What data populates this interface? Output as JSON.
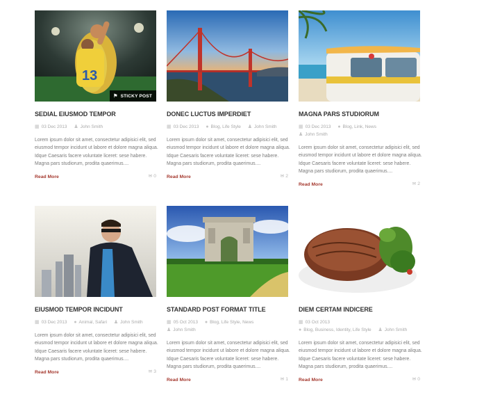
{
  "read_more_label": "Read More",
  "excerpt": "Lorem ipsum dolor sit amet, consectetur adipisici elit, sed eiusmod tempor incidunt ut labore et dolore magna aliqua. Idque Caesaris facere voluntate liceret: sese habere. Magna pars studiorum, prodita quaerimus....",
  "posts": [
    {
      "title": "SEDIAL EIUSMOD TEMPOR",
      "date": "03 Dec 2013",
      "tags": "",
      "author": "John Smith",
      "comments": "0",
      "sticky_label": "STICKY POST",
      "image": "soccer-players-photo"
    },
    {
      "title": "DONEC LUCTUS IMPERDIET",
      "date": "03 Dec 2013",
      "tags": "Blog, Life Style",
      "author": "John Smith",
      "comments": "2",
      "image": "golden-gate-bridge-photo"
    },
    {
      "title": "MAGNA PARS STUDIORUM",
      "date": "03 Dec 2013",
      "tags": "Blog, Link, News",
      "author": "John Smith",
      "comments": "2",
      "image": "surf-van-beach-photo"
    },
    {
      "title": "EIUSMOD TEMPOR INCIDUNT",
      "date": "03 Dec 2013",
      "tags": "Animal, Safari",
      "author": "John Smith",
      "comments": "3",
      "image": "businessman-superhero-photo"
    },
    {
      "title": "STANDARD POST FORMAT TITLE",
      "date": "05 Oct 2013",
      "tags": "Blog, Life Style, News",
      "author": "John Smith",
      "comments": "1",
      "image": "arc-de-triomphe-photo"
    },
    {
      "title": "DIEM CERTAM INDICERE",
      "date": "03 Oct 2013",
      "tags": "Blog, Business, Identity, Life Style",
      "author": "John Smith",
      "comments": "0",
      "image": "steak-plate-photo"
    }
  ],
  "icons": {
    "date": "calendar-icon",
    "tags": "tag-icon",
    "author": "user-icon",
    "comments": "comment-icon",
    "sticky": "pin-icon"
  },
  "colors": {
    "read_more": "#a5392f",
    "title": "#333333",
    "meta": "#a8a8a8"
  }
}
